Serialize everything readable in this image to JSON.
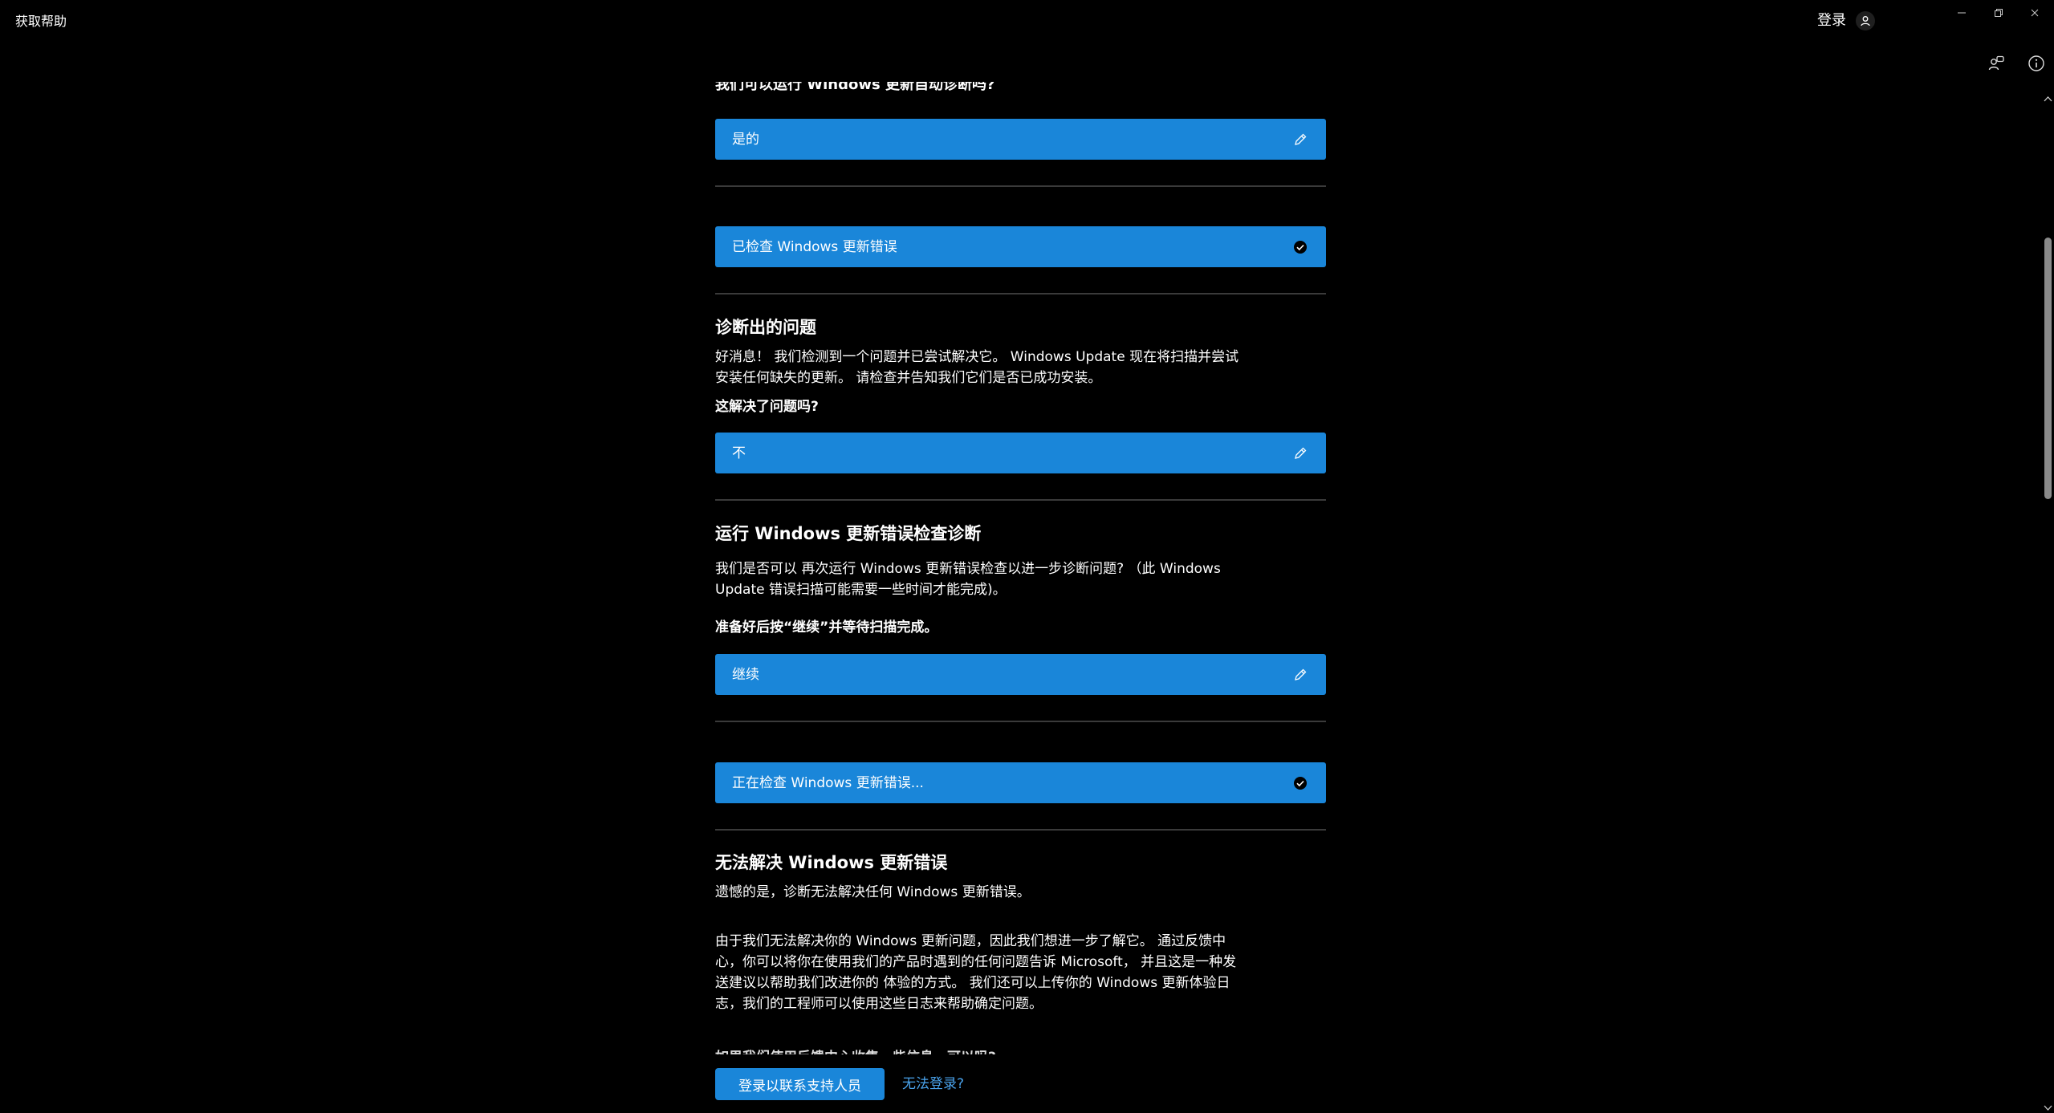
{
  "window": {
    "title": "获取帮助",
    "sign_in_label": "登录"
  },
  "conversation": {
    "cut_heading": "我们可以运行 Windows 更新自动诊断吗?",
    "answer_1": "是的",
    "status_1": "已检查 Windows 更新错误",
    "diag_heading": "诊断出的问题",
    "diag_text_1": "好消息！ 我们检测到一个问题并已尝试解决它。 Windows Update 现在将扫描并尝试",
    "diag_text_2": "安装任何缺失的更新。 请检查并告知我们它们是否已成功安装。",
    "diag_question": "这解决了问题吗?",
    "answer_2": "不",
    "run_heading": "运行 Windows 更新错误检查诊断",
    "run_text_1": "我们是否可以 再次运行 Windows 更新错误检查以进一步诊断问题? （此 Windows",
    "run_text_2": "Update 错误扫描可能需要一些时间才能完成)。",
    "run_prompt": "准备好后按“继续”并等待扫描完成。",
    "answer_3": "继续",
    "status_2": "正在检查 Windows 更新错误...",
    "fail_heading": "无法解决 Windows 更新错误",
    "fail_text": "遗憾的是，诊断无法解决任何 Windows 更新错误。",
    "feedback_1": "由于我们无法解决你的 Windows 更新问题，因此我们想进一步了解它。 通过反馈中",
    "feedback_2": "心，你可以将你在使用我们的产品时遇到的任何问题告诉 Microsoft， 并且这是一种发",
    "feedback_3": "送建议以帮助我们改进你的 体验的方式。 我们还可以上传你的 Windows 更新体验日",
    "feedback_4": "志，我们的工程师可以使用这些日志来帮助确定问题。",
    "cut_bottom": "如果我们使用反馈中心收集一些信息，可以吗?"
  },
  "footer": {
    "contact_button": "登录以联系支持人员",
    "cant_sign_in_link": "无法登录?"
  },
  "icons": {
    "edit": "pencil-icon",
    "done": "check-circle-icon",
    "user": "person-icon",
    "share": "share-icon",
    "info": "info-icon"
  },
  "colors": {
    "accent": "#1a86d9",
    "link": "#4aa3ec",
    "background": "#000000"
  }
}
